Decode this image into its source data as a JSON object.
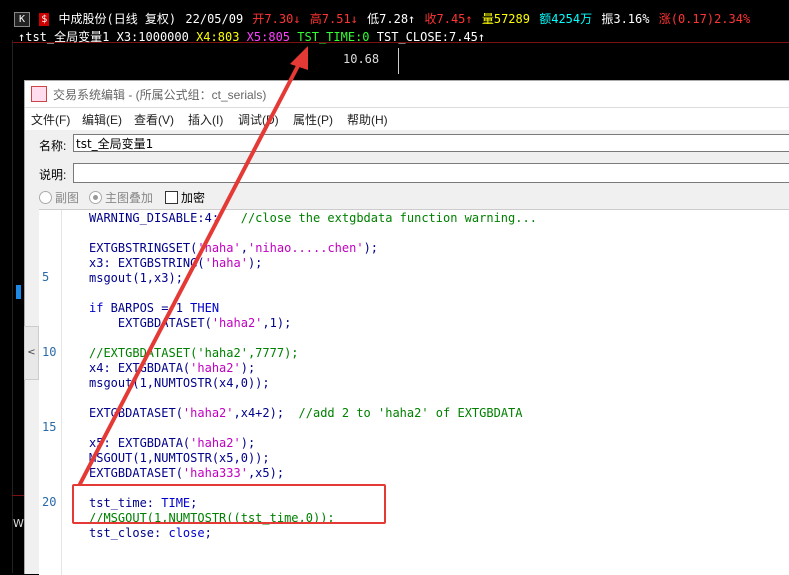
{
  "quote": {
    "k_label": "K",
    "s_label": "$",
    "stock": "中成股份(日线 复权)",
    "date": "22/05/09",
    "open": "开7.30↓",
    "high": "高7.51↓",
    "low": "低7.28↑",
    "close": "收7.45↑",
    "volume": "量57289",
    "amount": "额4254万",
    "amplitude": "振3.16%",
    "change": "涨(0.17)2.34%"
  },
  "indicator": {
    "name": "↑tst_全局变量1",
    "x3": "X3:1000000",
    "x4": "X4:803",
    "x5": "X5:805",
    "tst_time": "TST_TIME:0",
    "tst_close": "TST_CLOSE:7.45↑"
  },
  "chart": {
    "price_label": "10.68",
    "w_label": "W"
  },
  "dialog": {
    "title": "交易系统编辑 - (所属公式组：ct_serials)",
    "menu": [
      "文件(F)",
      "编辑(E)",
      "查看(V)",
      "插入(I)",
      "调试(D)",
      "属性(P)",
      "帮助(H)"
    ],
    "name_label": "名称:",
    "name_value": "tst_全局变量1",
    "desc_label": "说明:",
    "desc_value": "",
    "options": {
      "sub_chart": "副图",
      "main_overlay": "主图叠加",
      "encrypt": "加密"
    }
  },
  "editor": {
    "line_numbers": [
      "5",
      "10",
      "15",
      "20"
    ],
    "collapse_glyph": "<",
    "lines": [
      {
        "t": "WARNING_DISABLE:4;   ",
        "c": "//close the extgbdata function warning..."
      },
      {
        "t": "",
        "c": ""
      },
      {
        "t": "EXTGBSTRINGSET('haha','nihao.....chen');",
        "c": ""
      },
      {
        "t": "x3: EXTGBSTRING('haha');",
        "c": ""
      },
      {
        "t": "msgout(1,x3);",
        "c": ""
      },
      {
        "t": "",
        "c": ""
      },
      {
        "t": "if BARPOS = 1 THEN",
        "c": ""
      },
      {
        "t": "    EXTGBDATASET('haha2',1);",
        "c": ""
      },
      {
        "t": "",
        "c": ""
      },
      {
        "t": "",
        "c": "//EXTGBDATASET('haha2',7777);"
      },
      {
        "t": "x4: EXTGBDATA('haha2');",
        "c": ""
      },
      {
        "t": "msgout(1,NUMTOSTR(x4,0));",
        "c": ""
      },
      {
        "t": "",
        "c": ""
      },
      {
        "t": "EXTGBDATASET('haha2',x4+2);  ",
        "c": "//add 2 to 'haha2' of EXTGBDATA"
      },
      {
        "t": "",
        "c": ""
      },
      {
        "t": "x5: EXTGBDATA('haha2');",
        "c": ""
      },
      {
        "t": "MSGOUT(1,NUMTOSTR(x5,0));",
        "c": ""
      },
      {
        "t": "EXTGBDATASET('haha333',x5);",
        "c": ""
      },
      {
        "t": "",
        "c": ""
      },
      {
        "t": "tst_time: TIME;",
        "c": ""
      },
      {
        "t": "",
        "c": "//MSGOUT(1,NUMTOSTR((tst_time,0));"
      },
      {
        "t": "tst_close: close;",
        "c": ""
      }
    ]
  },
  "colors": {
    "red": "#ff3333",
    "green": "#33ff33",
    "yellow": "#ffff00",
    "cyan": "#00ffff",
    "magenta": "#ff40ff",
    "annotation": "#e53935"
  }
}
